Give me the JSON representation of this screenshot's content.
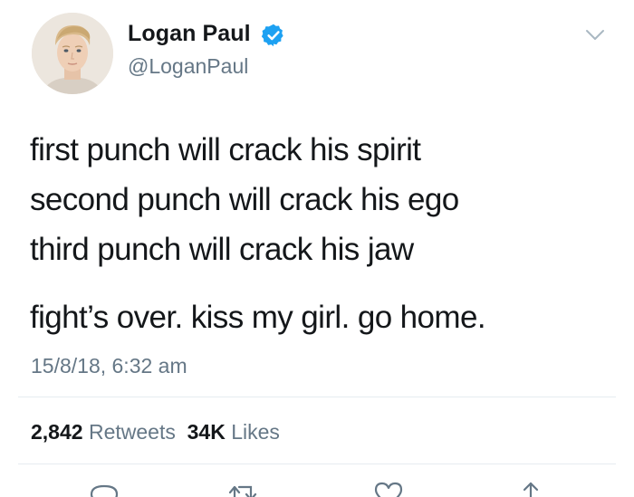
{
  "tweet": {
    "author": {
      "display_name": "Logan Paul",
      "handle": "@LoganPaul",
      "verified": true,
      "verified_color": "#1da1f2"
    },
    "text_lines": [
      "first punch will crack his spirit",
      "second punch will crack his ego",
      "third punch will crack his jaw",
      "fight’s over. kiss my girl. go home."
    ],
    "timestamp": "15/8/18, 6:32 am",
    "stats": {
      "retweets_count": "2,842",
      "retweets_label": "Retweets",
      "likes_count": "34K",
      "likes_label": "Likes"
    },
    "actions": {
      "icons": [
        "reply-icon",
        "retweet-icon",
        "like-icon",
        "share-icon"
      ]
    }
  },
  "colors": {
    "text_primary": "#14171a",
    "text_secondary": "#657786",
    "divider": "#e6ecf0",
    "accent": "#1da1f2"
  }
}
